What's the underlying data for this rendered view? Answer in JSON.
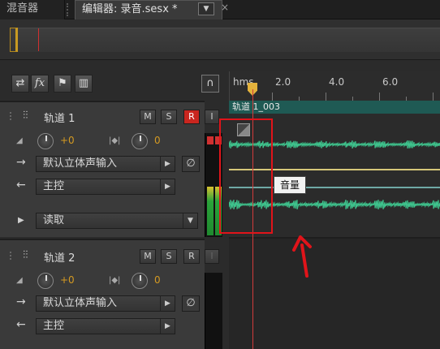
{
  "tabs": {
    "mixer_label": "混音器",
    "editor_label": "编辑器: 录音.sesx *",
    "menu_icon": "chevron-down-icon",
    "close_label": "×"
  },
  "toolbar": {
    "icons": [
      "swap-icon",
      "fx-icon",
      "send-icon",
      "eq-bars-icon"
    ],
    "headphones_icon": "headphones-icon"
  },
  "ruler": {
    "unit": "hms",
    "labels": [
      "2.0",
      "4.0",
      "6.0"
    ]
  },
  "tracks": [
    {
      "name": "轨道 1",
      "mute": "M",
      "solo": "S",
      "record": "R",
      "input_monitor": "I",
      "record_armed": true,
      "volume": "+0",
      "pan": "0",
      "input": "默认立体声输入",
      "output": "主控",
      "automation_mode": "读取"
    },
    {
      "name": "轨道 2",
      "mute": "M",
      "solo": "S",
      "record": "R",
      "input_monitor": "I",
      "record_armed": false,
      "volume": "+0",
      "pan": "0",
      "input": "默认立体声输入",
      "output": "主控"
    }
  ],
  "clip": {
    "name": "轨道 1_003"
  },
  "tooltip": {
    "text": "音量"
  },
  "colors": {
    "clip_header": "#1f5a54",
    "waveform": "#3ec28c",
    "volume_envelope": "#d6c77a",
    "record_button": "#c9261f",
    "knob_value": "#d49a22",
    "annotation": "#e0141a"
  }
}
